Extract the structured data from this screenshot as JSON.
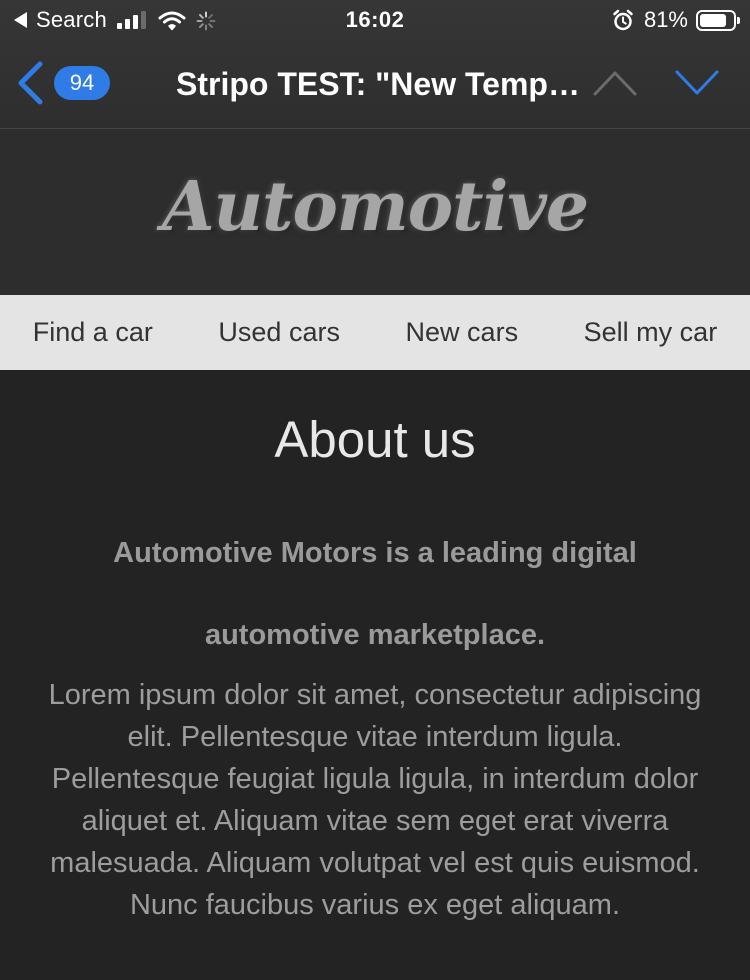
{
  "status_bar": {
    "back_app_label": "Search",
    "time": "16:02",
    "battery_percent_label": "81%",
    "battery_level": 0.81,
    "signal_bars_filled": 3,
    "signal_bars_total": 4,
    "icons": [
      "back-triangle-icon",
      "cell-signal-icon",
      "wifi-icon",
      "activity-spinner-icon",
      "alarm-icon",
      "battery-icon"
    ]
  },
  "mail_nav": {
    "unread_count": "94",
    "subject": "Stripo TEST: \"New Template\"",
    "icons": [
      "back-chevron-icon",
      "previous-message-icon",
      "next-message-icon"
    ],
    "colors": {
      "accent": "#2f7ce6",
      "disabled": "#6b6b6b"
    }
  },
  "email": {
    "logo_text": "Automotive",
    "menu": [
      {
        "label": "Find a car"
      },
      {
        "label": "Used cars"
      },
      {
        "label": "New cars"
      },
      {
        "label": "Sell my car"
      }
    ],
    "about": {
      "title": "About us",
      "lead_line_1": "Automotive Motors is a leading digital",
      "lead_line_2": "automotive marketplace.",
      "body": "Lorem ipsum dolor sit amet, consectetur adipiscing elit. Pellentesque vitae interdum ligula. Pellentesque feugiat ligula ligula, in interdum dolor aliquet et. Aliquam vitae sem eget erat viverra malesuada. Aliquam volutpat vel est quis euismod. Nunc faucibus varius ex eget aliquam."
    },
    "colors": {
      "background": "#232323",
      "logo_band": "#2d2d2d",
      "menu_bar": "#e3e4e3"
    }
  }
}
